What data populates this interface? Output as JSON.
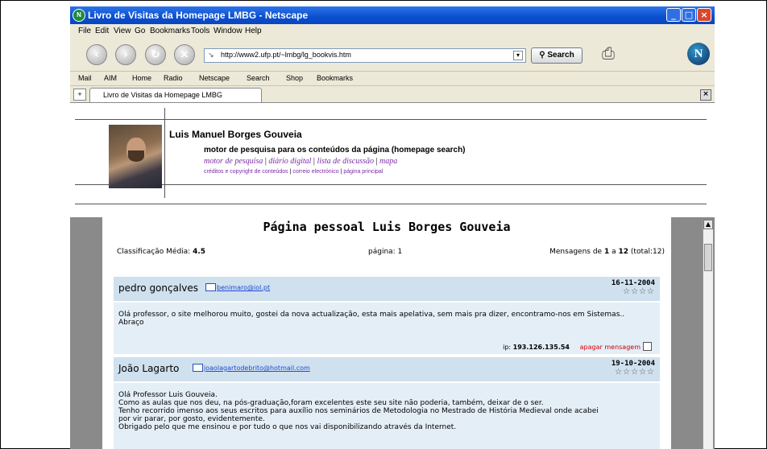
{
  "window": {
    "title": "Livro de Visitas da Homepage LMBG - Netscape",
    "controls": {
      "minimize": "_",
      "maximize": "□",
      "close": "×"
    }
  },
  "menu": [
    "File",
    "Edit",
    "View",
    "Go",
    "Bookmarks",
    "Tools",
    "Window",
    "Help"
  ],
  "nav": {
    "url": "http://www2.ufp.pt/~lmbg/lg_bookvis.htm",
    "search_label": "Search"
  },
  "personal_toolbar": [
    "Mail",
    "AIM",
    "Home",
    "Radio",
    "Netscape",
    "Search",
    "Shop",
    "Bookmarks"
  ],
  "tab": {
    "label": "Livro de Visitas da Homepage LMBG"
  },
  "header": {
    "name": "Luis Manuel Borges Gouveia",
    "subtitle": "motor de pesquisa para os conteúdos da página (homepage search)",
    "links": [
      "motor de pesquisa",
      "diário digital",
      "lista de discussão",
      "mapa"
    ],
    "small_links": [
      "créditos e copyright de conteúdos",
      "correio electrónico",
      "página principal"
    ]
  },
  "guestbook": {
    "title": "Página pessoal Luis Borges Gouveia",
    "rating_label": "Classificação Média:",
    "rating_value": "4.5",
    "page_label": "página: 1",
    "messages_prefix": "Mensagens de",
    "messages_from": "1",
    "messages_mid": "a",
    "messages_to": "12",
    "messages_total": "(total:12)",
    "entries": [
      {
        "name": "pedro gonçalves",
        "email": "benimaro@iol.pt",
        "date": "16-11-2004",
        "stars": "☆☆☆☆",
        "text": "Olá professor, o site melhorou muito, gostei da nova actualização, esta mais apelativa, sem mais pra dizer, encontramo-nos em Sistemas.. Abraço",
        "ip_label": "ip:",
        "ip": "193.126.135.54",
        "delete_label": "apagar mensagem"
      },
      {
        "name": "João Lagarto",
        "email": "joaolagartodebrito@hotmail.com",
        "date": "19-10-2004",
        "stars": "☆☆☆☆☆",
        "text_lines": [
          "Olá Professor Luis Gouveia.",
          "Como as aulas que nos deu, na pós-graduação,foram excelentes este seu site não poderia, também, deixar de o ser.",
          "Tenho recorrido imenso aos seus escritos para auxílio nos seminários de Metodologia no Mestrado de História Medieval onde acabei",
          "por vir parar, por gosto, evidentemente.",
          "Obrigado pelo que me ensinou e por tudo o que nos vai disponibilizando através da Internet."
        ]
      }
    ]
  }
}
